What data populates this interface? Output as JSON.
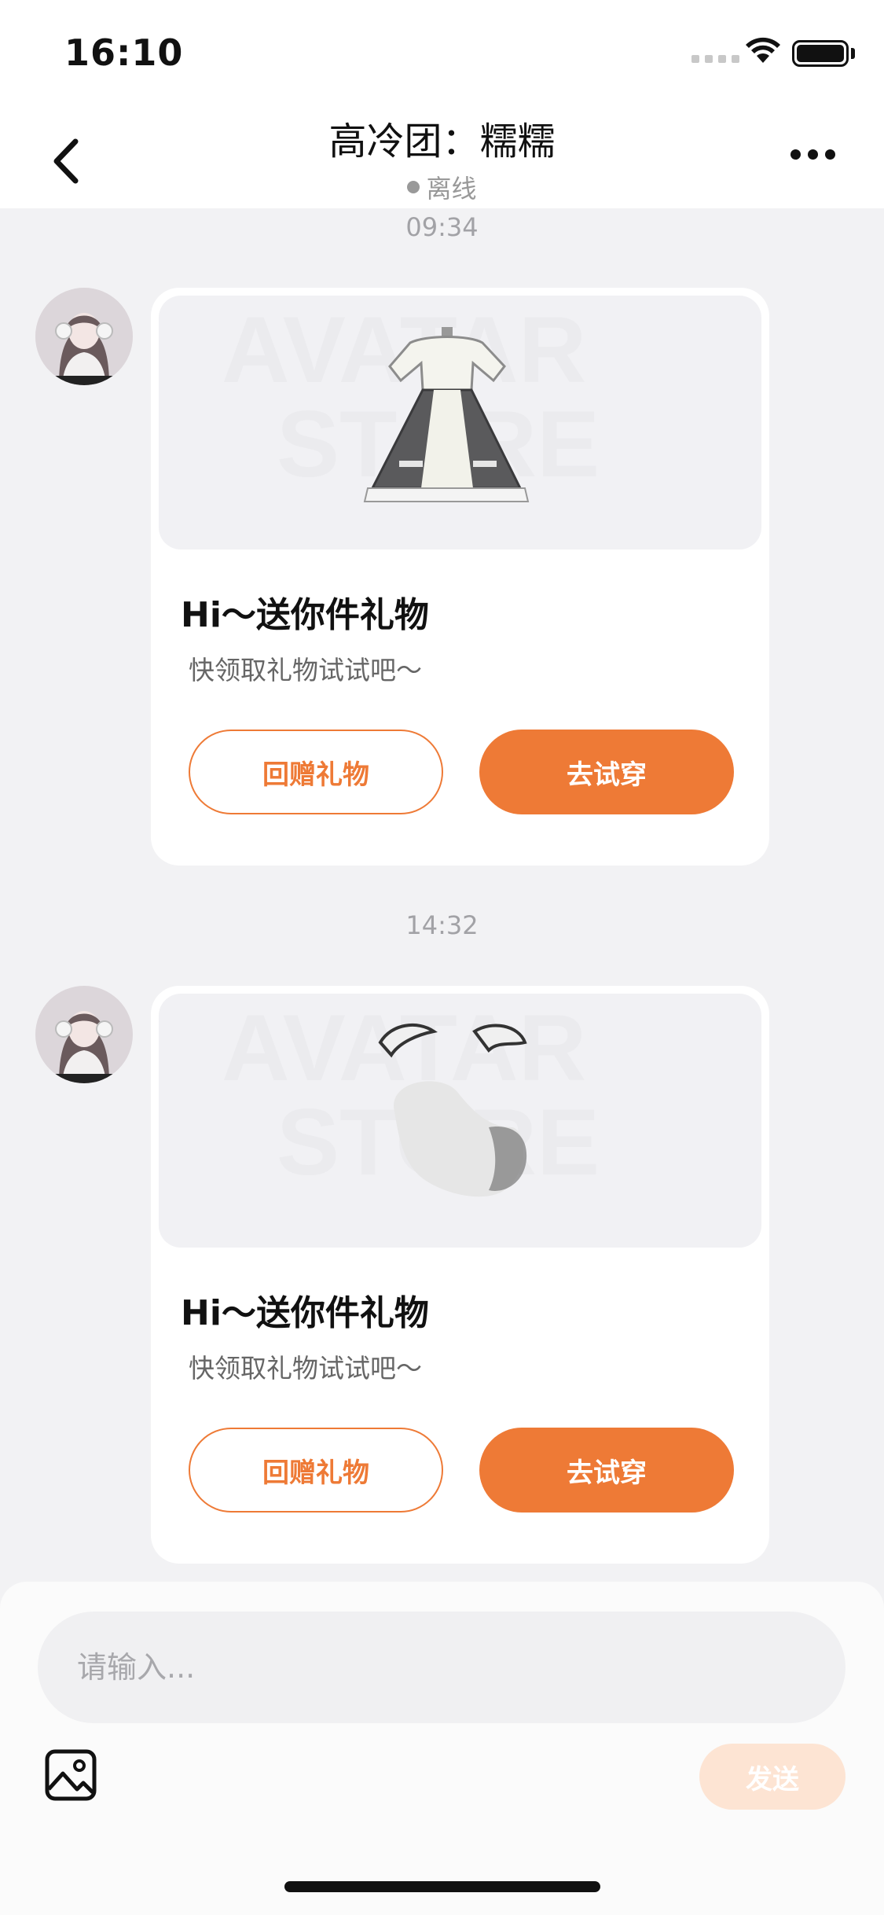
{
  "status_bar": {
    "time": "16:10"
  },
  "header": {
    "title": "高冷团：糯糯",
    "status": "离线"
  },
  "messages": [
    {
      "timestamp": "09:34",
      "card": {
        "title": "Hi～送你件礼物",
        "subtitle": "快领取礼物试试吧～",
        "return_gift_label": "回赠礼物",
        "try_on_label": "去试穿"
      }
    },
    {
      "timestamp": "14:32",
      "card": {
        "title": "Hi～送你件礼物",
        "subtitle": "快领取礼物试试吧～",
        "return_gift_label": "回赠礼物",
        "try_on_label": "去试穿"
      }
    }
  ],
  "watermark": [
    "AVATAR",
    "STORE"
  ],
  "input": {
    "placeholder": "请输入..."
  },
  "send_label": "发送",
  "colors": {
    "accent": "#ee7a36",
    "send_disabled": "#fde4d3",
    "background": "#f2f2f4"
  }
}
